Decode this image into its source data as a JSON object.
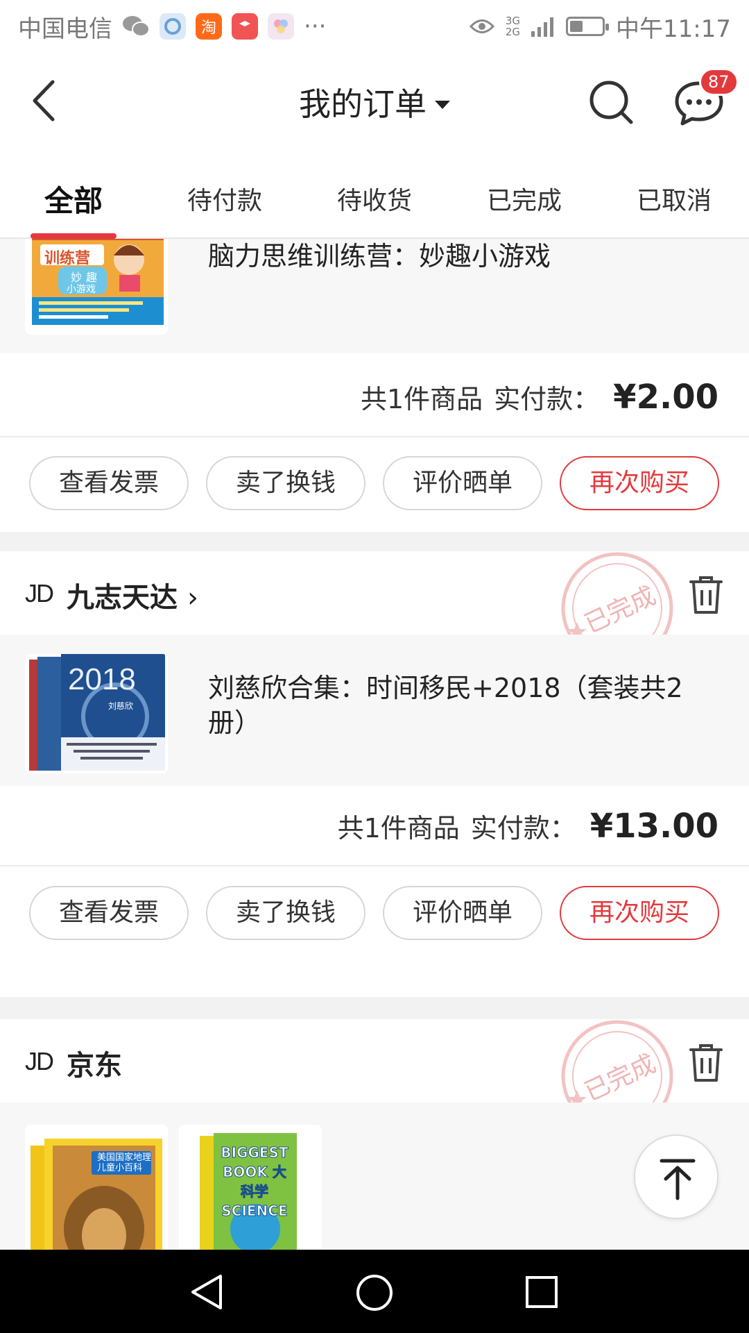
{
  "status_bar": {
    "carrier": "中国电信",
    "apps": [
      {
        "icon": "wechat-icon"
      },
      {
        "icon": "browser-icon"
      },
      {
        "icon": "taobao-icon",
        "glyph": "淘"
      },
      {
        "icon": "app-icon"
      },
      {
        "icon": "photos-icon"
      }
    ],
    "more": "···",
    "network_top": "3G",
    "network_bottom": "2G",
    "time": "中午11:17",
    "colors": {
      "taobao": "#ff6a1a",
      "app": "#f05454"
    }
  },
  "header": {
    "title": "我的订单",
    "message_badge": "87"
  },
  "tabs": [
    {
      "label": "全部",
      "active": true
    },
    {
      "label": "待付款"
    },
    {
      "label": "待收货"
    },
    {
      "label": "已完成"
    },
    {
      "label": "已取消"
    }
  ],
  "orders": [
    {
      "product_name": "脑力思维训练营：妙趣小游戏",
      "cover": {
        "banner": "训练营",
        "sub1": "妙",
        "sub2": "趣",
        "sub3": "小游戏"
      },
      "summary_count": "共1件商品",
      "summary_label": "实付款：",
      "price": "¥2.00",
      "buttons": [
        "查看发票",
        "卖了换钱",
        "评价晒单",
        "再次购买"
      ]
    },
    {
      "shop_logo": "JD",
      "shop_name": "九志天达",
      "stamp": "已完成",
      "product_name": "刘慈欣合集：时间移民+2018（套装共2册）",
      "cover": {
        "year": "2018",
        "author": "刘慈欣"
      },
      "summary_count": "共1件商品",
      "summary_label": "实付款：",
      "price": "¥13.00",
      "buttons": [
        "查看发票",
        "卖了换钱",
        "评价晒单",
        "再次购买"
      ]
    },
    {
      "shop_logo": "JD",
      "shop_name": "京东",
      "stamp": "已完成",
      "covers": [
        {
          "title": "美国国家地理 儿童小百科"
        },
        {
          "title": "BIGGEST BOOK 大科学 SCIENCE"
        }
      ]
    }
  ],
  "accent_color": "#e4393c"
}
